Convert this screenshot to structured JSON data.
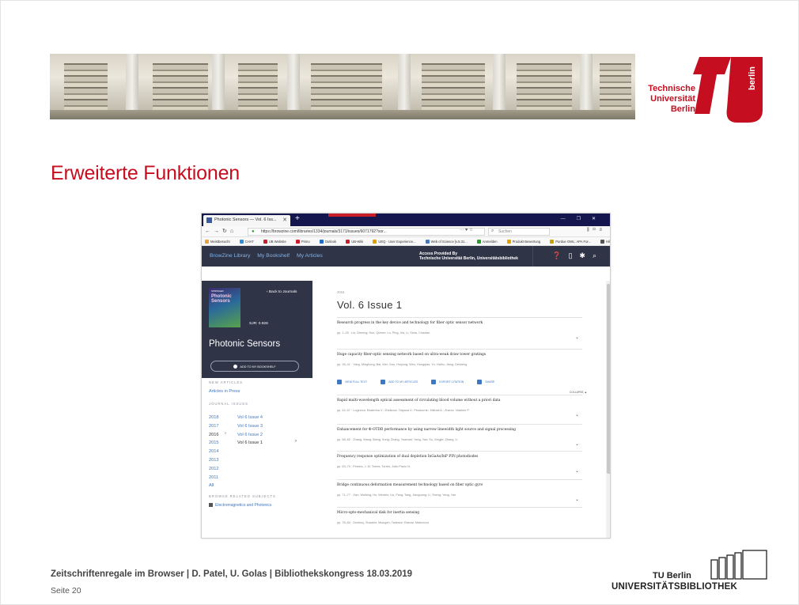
{
  "slide": {
    "title": "Erweiterte Funktionen",
    "footer_title": "Zeitschriftenregale im Browser | D. Patel, U. Golas | Bibliothekskongress 18.03.2019",
    "footer_page": "Seite 20"
  },
  "tu_logo": {
    "line1": "Technische",
    "line2": "Universität",
    "line3": "Berlin",
    "vertical": "berlin"
  },
  "ub_logo": {
    "tu": "TU Berlin",
    "name": "UNIVERSITÄTSBIBLIOTHEK"
  },
  "browser": {
    "tab_title": "Photonic Sensors — Vol. 6 Iss...",
    "new_tab": "+",
    "url": "https://browzine.com/libraries/1334/journals/3171/issues/6071792?sor...",
    "url_icons": "··· ♥ ☆",
    "search_placeholder": "Suchen",
    "bookmarks": [
      {
        "label": "Meistbesucht",
        "color": "#e8a33a"
      },
      {
        "label": "CHAT",
        "color": "#2d8fdd"
      },
      {
        "label": "UB Website",
        "color": "#c81e2a"
      },
      {
        "label": "Primo",
        "color": "#c81e2a"
      },
      {
        "label": "Outlook",
        "color": "#1f6fc4"
      },
      {
        "label": "UB-Wiki",
        "color": "#c81e2a"
      },
      {
        "label": "UEQ - User Experience...",
        "color": "#e0a000"
      },
      {
        "label": "Web of Science [v.5.31...",
        "color": "#4a77b8"
      },
      {
        "label": "Anmelden",
        "color": "#2a9d2a"
      },
      {
        "label": "Produkt Bewertung",
        "color": "#e0a000"
      },
      {
        "label": "Purdue OWL: APA For...",
        "color": "#c8a200"
      },
      {
        "label": "Hilfe",
        "color": "#555555"
      }
    ]
  },
  "app": {
    "nav": [
      "BrowZine Library",
      "My Bookshelf",
      "My Articles"
    ],
    "access_line1": "Access Provided By",
    "access_line2": "Technische Universität Berlin, Universitätsbibliothek"
  },
  "journal": {
    "cover_publisher": "SPRINGER",
    "cover_title_1": "Photonic",
    "cover_title_2": "Sensors",
    "back_link": "‹ Back to Journals",
    "sjr": "SJR: 0.928",
    "name": "Photonic Sensors",
    "add_button": "ADD TO MY BOOKSHELF",
    "new_articles_label": "NEW ARTICLES",
    "articles_in_press": "Articles in Press",
    "journal_issues_label": "JOURNAL ISSUES",
    "years": [
      "2018",
      "2017",
      "2016",
      "2015",
      "2014",
      "2013",
      "2012",
      "2011",
      "All"
    ],
    "current_year": "2016",
    "issues": [
      "Vol 6 Issue 4",
      "Vol 6 Issue 3",
      "Vol 6 Issue 2",
      "Vol 6 Issue 1"
    ],
    "current_issue": "Vol 6 Issue 1",
    "browse_label": "BROWSE RELATED SUBJECTS",
    "subject": "Electromagnetics and Photonics"
  },
  "issue": {
    "year": "2016",
    "title": "Vol. 6 Issue 1",
    "actions": [
      "VIEW FULL TEXT",
      "ADD TO MY ARTICLES",
      "EXPORT CITATION",
      "SHARE"
    ],
    "collapse": "COLLAPSE ▲",
    "articles": [
      {
        "title": "Research progress in the key device and technology for fiber optic sensor network",
        "authors": "pp. 1–25  ·  Liu, Deming; Sun, Qizhen; Lu, Ping; Xia, Li; Sima, Chaotan"
      },
      {
        "title": "Huge capacity fiber-optic sensing network based on ultra-weak draw tower gratings",
        "authors": "pp. 26–41  ·  Yang, Minghong; Bai, Wei; Guo, Huiyong; Wen, Hongqiao; Yu, Haihu; Jiang, Desheng"
      },
      {
        "title": "Rapid multi-wavelength optical assessment of circulating blood volume without a priori data",
        "authors": "pp. 42–57  ·  Loginova, Ekaterina V.; Zhidkova, Tatyana V.; Proskurnin, Mikhail A.; Zharov, Vladimir P."
      },
      {
        "title": "Enhancement for Φ-OTDR performance by using narrow linewidth light source and signal processing",
        "authors": "pp. 58–62  ·  Zhang, Wang; Wang, Song; Zhang, Yuanwei; Yang, Yao; Su, Xingjie; Zhang, Li"
      },
      {
        "title": "Frequency response optimization of dual depletion InGaAs/InP PIN photodiodes",
        "authors": "pp. 63–70  ·  Pereira, J. M. Torres; Torres, João Paulo N."
      },
      {
        "title": "Bridge continuous deformation measurement technology based on fiber optic gyro",
        "authors": "pp. 71–77  ·  Gan, Weibing; Hu, Wenbin; Liu, Fang; Tang, Jianguang; Li, Sheng; Yang, Yan"
      },
      {
        "title": "Micro-opto-mechanical disk for inertia sensing",
        "authors": "pp. 78–84  ·  Dezfouy, Shaahin; Mulugeh; Tadesse; Rasnai, Mahmoud"
      }
    ]
  }
}
